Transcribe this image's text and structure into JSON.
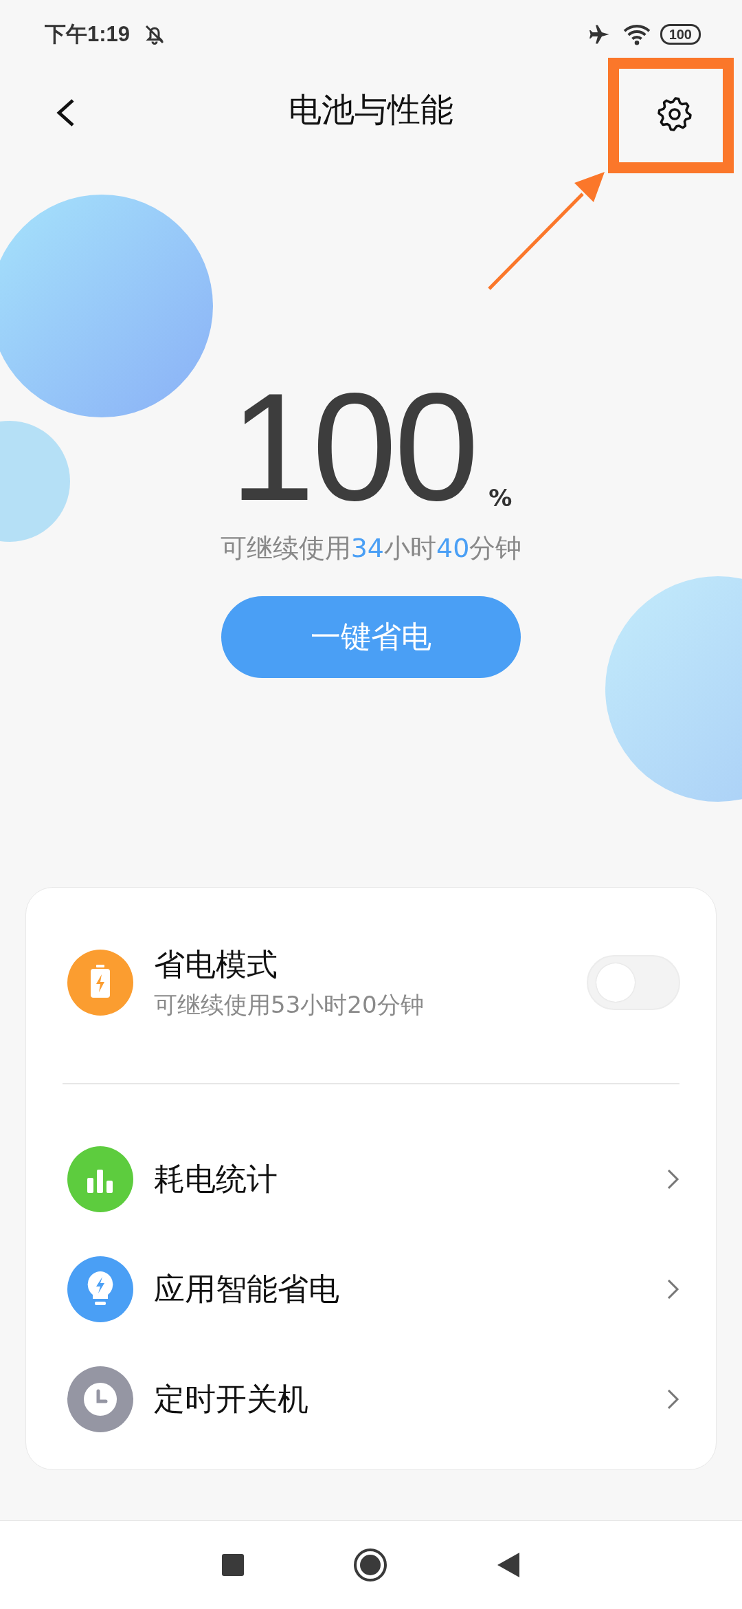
{
  "status_bar": {
    "time": "下午1:19",
    "battery": "100"
  },
  "header": {
    "title": "电池与性能"
  },
  "battery": {
    "percent": "100",
    "unit": "%",
    "remaining": [
      {
        "text": "可继续使用",
        "highlight": false
      },
      {
        "text": "34",
        "highlight": true
      },
      {
        "text": "小时",
        "highlight": false
      },
      {
        "text": "40",
        "highlight": true
      },
      {
        "text": "分钟",
        "highlight": false
      }
    ],
    "button": "一键省电"
  },
  "card": {
    "items": [
      {
        "kind": "toggle",
        "title": "省电模式",
        "subtitle": "可继续使用53小时20分钟",
        "on": false,
        "color": "#fb9d30"
      },
      {
        "kind": "link",
        "title": "耗电统计",
        "color": "#5dcc3e"
      },
      {
        "kind": "link",
        "title": "应用智能省电",
        "color": "#4a9ff5"
      },
      {
        "kind": "link",
        "title": "定时开关机",
        "color": "#9596a3"
      }
    ]
  }
}
